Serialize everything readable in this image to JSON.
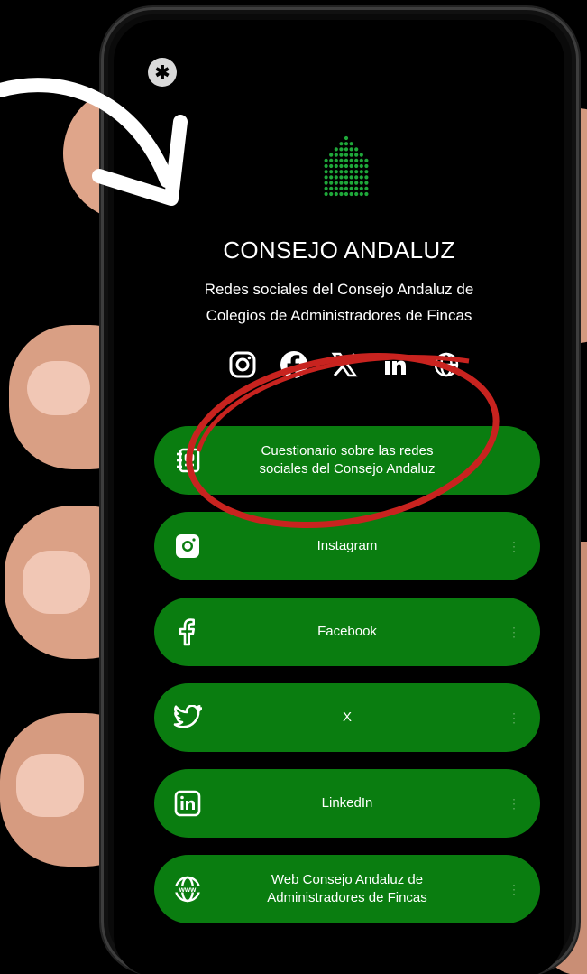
{
  "profile": {
    "title": "CONSEJO ANDALUZ",
    "subtitle_line1": "Redes sociales del Consejo Andaluz de",
    "subtitle_line2": "Colegios de Administradores de Fincas"
  },
  "menu_button_glyph": "✱",
  "social_icons": [
    "instagram-icon",
    "facebook-icon",
    "x-icon",
    "linkedin-icon",
    "globe-icon"
  ],
  "links": [
    {
      "icon": "survey-icon",
      "line1": "Cuestionario sobre las redes",
      "line2": "sociales del Consejo Andaluz"
    },
    {
      "icon": "instagram-icon",
      "line1": "Instagram",
      "line2": ""
    },
    {
      "icon": "facebook-icon",
      "line1": "Facebook",
      "line2": ""
    },
    {
      "icon": "twitter-icon",
      "line1": "X",
      "line2": ""
    },
    {
      "icon": "linkedin-icon",
      "line1": "LinkedIn",
      "line2": ""
    },
    {
      "icon": "www-icon",
      "line1": "Web Consejo Andaluz de",
      "line2": "Administradores de Fincas"
    }
  ],
  "colors": {
    "background": "#000000",
    "button_green": "#0a7d10",
    "logo_green": "#1fa83a",
    "annotation_red": "#c8231f",
    "annotation_arrow": "#ffffff"
  }
}
